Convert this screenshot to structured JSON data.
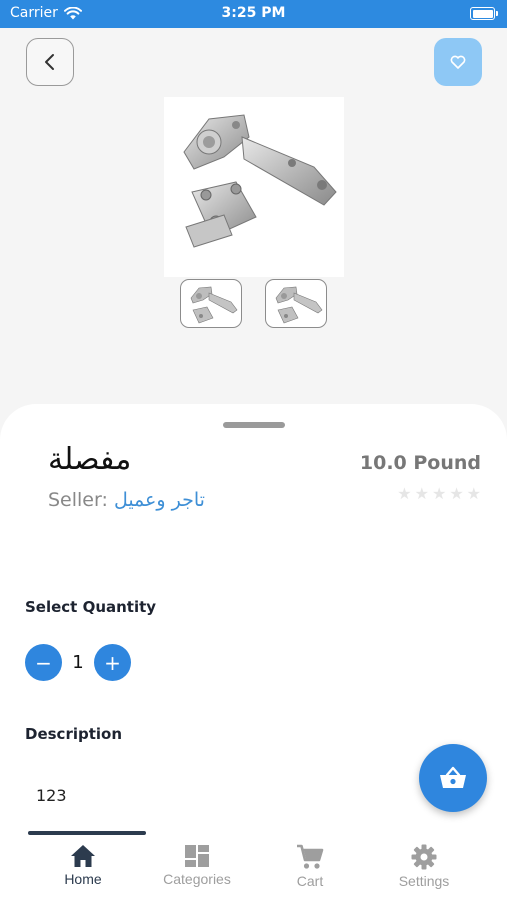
{
  "status_bar": {
    "carrier": "Carrier",
    "time": "3:25 PM"
  },
  "header": {
    "back_icon": "chevron-left-icon",
    "favorite_icon": "heart-icon"
  },
  "product": {
    "name": "مفصلة",
    "price": "10.0 Pound",
    "rating": 0,
    "rating_max": 5,
    "seller_label": "Seller:",
    "seller_name": "تاجر وعميل"
  },
  "quantity": {
    "title": "Select Quantity",
    "value": "1",
    "minus": "−",
    "plus": "+"
  },
  "description": {
    "title": "Description",
    "text": "123"
  },
  "fab": {
    "icon": "basket-icon"
  },
  "tabs": [
    {
      "label": "Home",
      "icon": "home-icon",
      "active": true
    },
    {
      "label": "Categories",
      "icon": "grid-icon",
      "active": false
    },
    {
      "label": "Cart",
      "icon": "cart-icon",
      "active": false
    },
    {
      "label": "Settings",
      "icon": "gear-icon",
      "active": false
    }
  ],
  "colors": {
    "primary": "#2f86de",
    "status_bar": "#2d8ae0",
    "favorite_bg": "#8ec8f5",
    "active_tab": "#2c3b4e",
    "inactive_tab": "#9e9e9e"
  }
}
